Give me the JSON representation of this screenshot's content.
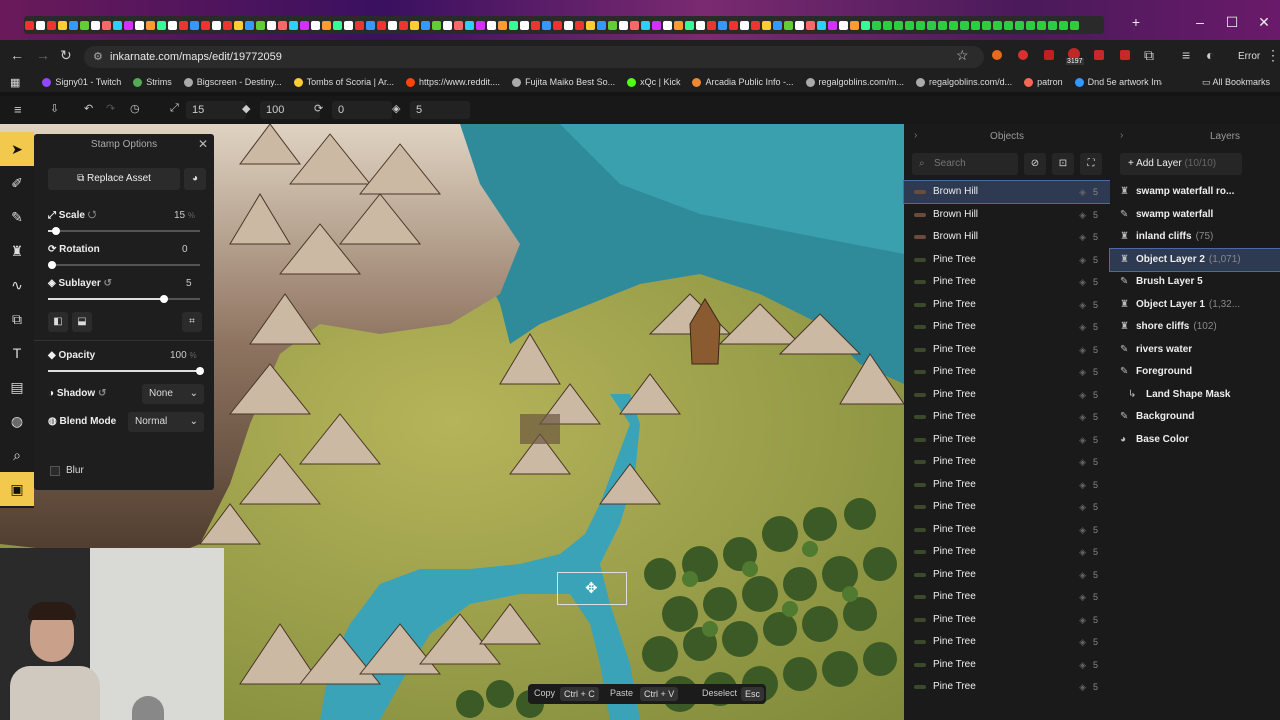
{
  "browser": {
    "url": "inkarnate.com/maps/edit/19772059",
    "error_label": "Error",
    "bookmarks": [
      "Signy01 - Twitch",
      "Strims",
      "Bigscreen - Destiny...",
      "Tombs of Scoria | Ar...",
      "https://www.reddit....",
      "Fujita Maiko Best So...",
      "xQc | Kick",
      "Arcadia Public Info -...",
      "regalgoblins.com/m...",
      "regalgoblins.com/d...",
      "patron",
      "Dnd 5e artwork Ima..."
    ],
    "all_bookmarks": "All Bookmarks",
    "ext_badge": "3197"
  },
  "toolbar": {
    "scale_value": "15",
    "opacity_value": "100",
    "rotation_value": "0",
    "layer_value": "5"
  },
  "stamp": {
    "title": "Stamp Options",
    "replace_label": "Replace Asset",
    "scale_label": "Scale",
    "scale_value": "15",
    "scale_unit": "%",
    "scale_level": 0.05,
    "rotation_label": "Rotation",
    "rotation_value": "0",
    "rotation_level": 0,
    "sublayer_label": "Sublayer",
    "sublayer_value": "5",
    "sublayer_level": 0.76,
    "opacity_label": "Opacity",
    "opacity_value": "100",
    "opacity_unit": "%",
    "opacity_level": 1,
    "shadow_label": "Shadow",
    "shadow_value": "None",
    "blend_label": "Blend Mode",
    "blend_value": "Normal",
    "blur_label": "Blur"
  },
  "objects": {
    "title": "Objects",
    "search_placeholder": "Search",
    "items": [
      {
        "name": "Brown Hill",
        "num": "5"
      },
      {
        "name": "Brown Hill",
        "num": "5"
      },
      {
        "name": "Brown Hill",
        "num": "5"
      },
      {
        "name": "Pine Tree",
        "num": "5"
      },
      {
        "name": "Pine Tree",
        "num": "5"
      },
      {
        "name": "Pine Tree",
        "num": "5"
      },
      {
        "name": "Pine Tree",
        "num": "5"
      },
      {
        "name": "Pine Tree",
        "num": "5"
      },
      {
        "name": "Pine Tree",
        "num": "5"
      },
      {
        "name": "Pine Tree",
        "num": "5"
      },
      {
        "name": "Pine Tree",
        "num": "5"
      },
      {
        "name": "Pine Tree",
        "num": "5"
      },
      {
        "name": "Pine Tree",
        "num": "5"
      },
      {
        "name": "Pine Tree",
        "num": "5"
      },
      {
        "name": "Pine Tree",
        "num": "5"
      },
      {
        "name": "Pine Tree",
        "num": "5"
      },
      {
        "name": "Pine Tree",
        "num": "5"
      },
      {
        "name": "Pine Tree",
        "num": "5"
      },
      {
        "name": "Pine Tree",
        "num": "5"
      },
      {
        "name": "Pine Tree",
        "num": "5"
      },
      {
        "name": "Pine Tree",
        "num": "5"
      },
      {
        "name": "Pine Tree",
        "num": "5"
      },
      {
        "name": "Pine Tree",
        "num": "5"
      }
    ]
  },
  "layers": {
    "title": "Layers",
    "add_label": "Add Layer",
    "add_count": "(10/10)",
    "items": [
      {
        "name": "swamp waterfall ro...",
        "count": ""
      },
      {
        "name": "swamp waterfall",
        "count": ""
      },
      {
        "name": "inland cliffs",
        "count": "(75)"
      },
      {
        "name": "Object Layer 2",
        "count": "(1,071)"
      },
      {
        "name": "Brush Layer 5",
        "count": ""
      },
      {
        "name": "Object Layer 1",
        "count": "(1,32..."
      },
      {
        "name": "shore cliffs",
        "count": "(102)"
      },
      {
        "name": "rivers water",
        "count": ""
      },
      {
        "name": "Foreground",
        "count": ""
      },
      {
        "name": "Land Shape Mask",
        "count": ""
      },
      {
        "name": "Background",
        "count": ""
      },
      {
        "name": "Base Color",
        "count": ""
      }
    ]
  },
  "bottom": {
    "copy": "Copy",
    "copy_key": "Ctrl + C",
    "paste": "Paste",
    "paste_key": "Ctrl + V",
    "deselect": "Deselect",
    "deselect_key": "Esc"
  }
}
